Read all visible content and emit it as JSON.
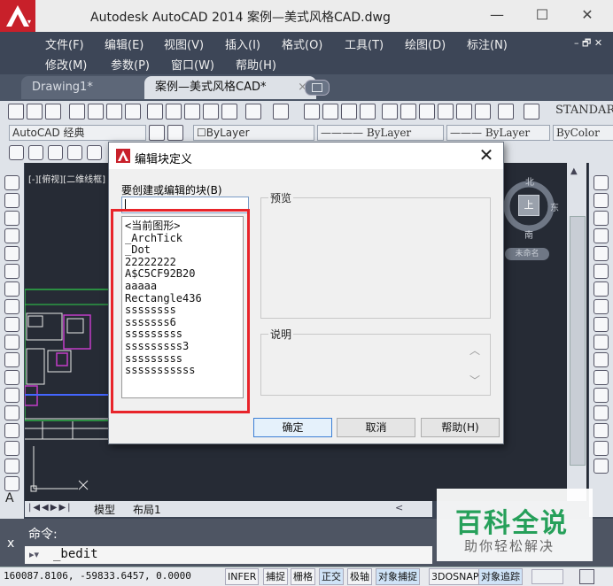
{
  "window": {
    "title": "Autodesk AutoCAD 2014    案例—美式风格CAD.dwg",
    "minimize": "—",
    "maximize": "☐",
    "close": "✕"
  },
  "menu": {
    "row1": [
      "文件(F)",
      "编辑(E)",
      "视图(V)",
      "插入(I)",
      "格式(O)",
      "工具(T)",
      "绘图(D)",
      "标注(N)"
    ],
    "row2": [
      "修改(M)",
      "参数(P)",
      "窗口(W)",
      "帮助(H)"
    ],
    "window_controls": "– 🗗 ✕"
  },
  "tabs": [
    {
      "label": "Drawing1*"
    },
    {
      "label": "案例—美式风格CAD*"
    }
  ],
  "tab_close": "×",
  "toolbar": {
    "text_style": "STANDAR",
    "workspace": "AutoCAD 经典",
    "layer_value": "ByLayer",
    "linetype": "ByLayer",
    "lineweight": "ByLayer",
    "color": "ByColor"
  },
  "drawing": {
    "viewport_label": "[-][俯视][二维线框]",
    "viewcube": {
      "north": "北",
      "south": "南",
      "east": "东",
      "top": "上",
      "unnamed": "未命名"
    }
  },
  "layout_tabs": {
    "model": "模型",
    "layout1": "布局1"
  },
  "command": {
    "label": "命令:",
    "input": "_bedit",
    "close": "x",
    "prompt_icon": "▸▾"
  },
  "status": {
    "coords": "160087.8106, -59833.6457, 0.0000",
    "buttons": [
      "INFER",
      "捕捉",
      "栅格",
      "正交",
      "极轴",
      "对象捕捉",
      "3DOSNAP",
      "对象追踪"
    ]
  },
  "dialog": {
    "title": "编辑块定义",
    "close": "✕",
    "block_name_label": "要创建或编辑的块(B)",
    "block_name_value": "",
    "blocks": [
      "<当前图形>",
      "_ArchTick",
      "_Dot",
      "22222222",
      "A$C5CF92B20",
      "aaaaa",
      "Rectangle436",
      "ssssssss",
      "sssssss6",
      "sssssssss",
      "sssssssss3",
      "sssssssss",
      "sssssssssss"
    ],
    "preview_label": "预览",
    "description_label": "说明",
    "ok_button": "确定",
    "cancel_button": "取消",
    "help_button": "帮助(H)"
  },
  "watermark": {
    "title": "百科全说",
    "subtitle": "助你轻松解决"
  },
  "colors": {
    "highlight": "#e8242a",
    "accent": "#c8202a",
    "watermark": "#26a05a"
  }
}
